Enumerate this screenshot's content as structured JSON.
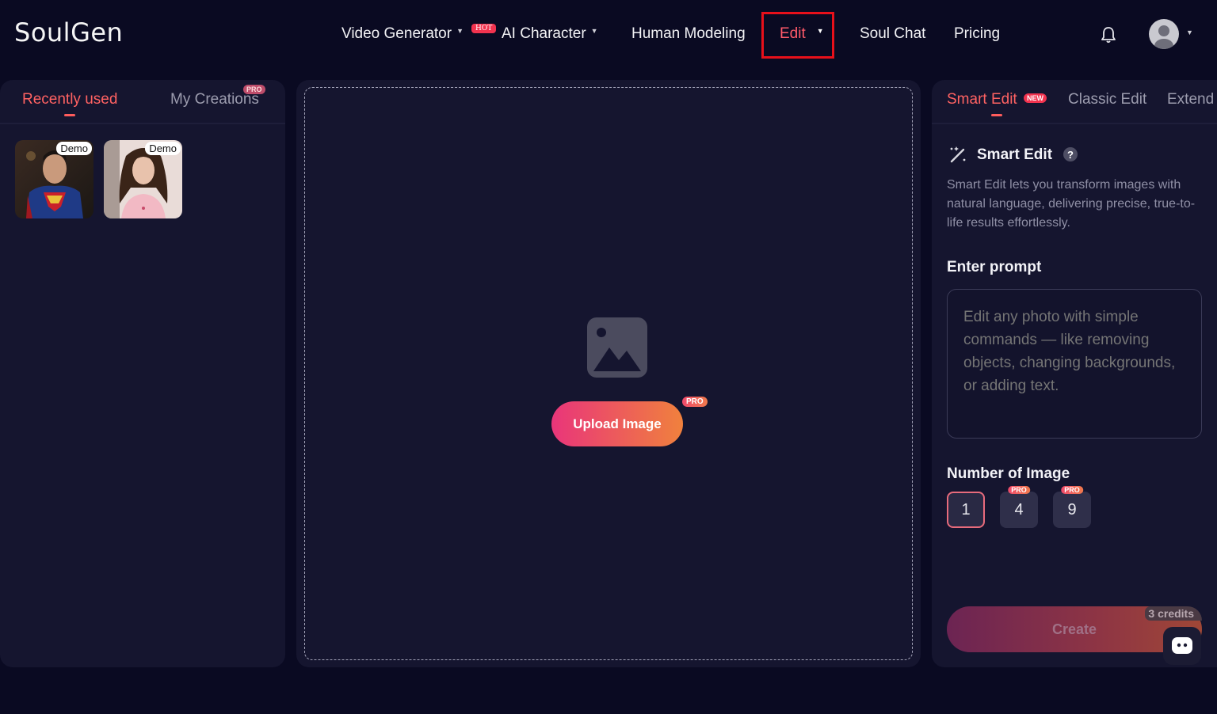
{
  "header": {
    "logo": "SoulGen",
    "nav": [
      {
        "label": "Video Generator"
      },
      {
        "label": "AI Character"
      },
      {
        "label": "Human Modeling"
      },
      {
        "label": "Edit"
      },
      {
        "label": "Soul Chat"
      },
      {
        "label": "Pricing"
      }
    ],
    "hot_badge": "HOT",
    "icons": {
      "notifications": "bell-icon",
      "profile": "user-avatar-icon"
    }
  },
  "left_panel": {
    "tabs": [
      {
        "label": "Recently used"
      },
      {
        "label": "My Creations"
      }
    ],
    "pro_badge": "PRO",
    "thumbnails": [
      {
        "tag": "Demo"
      },
      {
        "tag": "Demo"
      }
    ]
  },
  "center_panel": {
    "icon": "image-placeholder-icon",
    "upload_label": "Upload Image",
    "pro_badge": "PRO"
  },
  "right_panel": {
    "tabs": [
      {
        "label": "Smart Edit"
      },
      {
        "label": "Classic Edit"
      },
      {
        "label": "Extend"
      }
    ],
    "new_badge": "NEW",
    "section_title": "Smart Edit",
    "description": "Smart Edit lets you transform images with natural language, delivering precise, true-to-life results effortlessly.",
    "prompt_label": "Enter prompt",
    "prompt_placeholder": "Edit any photo with simple commands — like removing objects, changing backgrounds, or adding text.",
    "number_label": "Number of Image",
    "number_options": [
      {
        "value": "1"
      },
      {
        "value": "4",
        "badge": "PRO"
      },
      {
        "value": "9",
        "badge": "PRO"
      }
    ],
    "create_label": "Create",
    "credits": "3 credits"
  },
  "colors": {
    "accent": "#ff5a6a",
    "background": "#0a0a22",
    "panel": "#15152f",
    "highlight_box": "#e8101a"
  }
}
